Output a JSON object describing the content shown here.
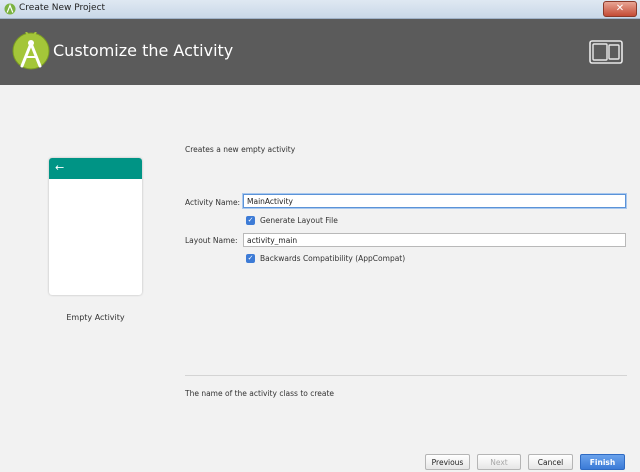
{
  "window": {
    "title": "Create New Project",
    "close_glyph": "✕"
  },
  "header": {
    "title": "Customize the Activity",
    "logo_icon": "android-studio-logo",
    "device_icon": "phone-tablet-icon"
  },
  "preview": {
    "template_name": "Empty Activity",
    "back_glyph": "←",
    "appbar_color": "#009485"
  },
  "form": {
    "description": "Creates a new empty activity",
    "activity_name_label": "Activity Name:",
    "activity_name_value": "MainActivity",
    "generate_layout_label": "Generate Layout File",
    "generate_layout_checked": true,
    "layout_name_label": "Layout Name:",
    "layout_name_value": "activity_main",
    "backwards_compat_label": "Backwards Compatibility (AppCompat)",
    "backwards_compat_checked": true,
    "check_glyph": "✓"
  },
  "hint": "The name of the activity class to create",
  "buttons": {
    "previous": "Previous",
    "next": "Next",
    "cancel": "Cancel",
    "finish": "Finish"
  },
  "colors": {
    "header_bg": "#5b5b5b",
    "accent_blue": "#3d7bd6",
    "android_green": "#a4c639"
  }
}
